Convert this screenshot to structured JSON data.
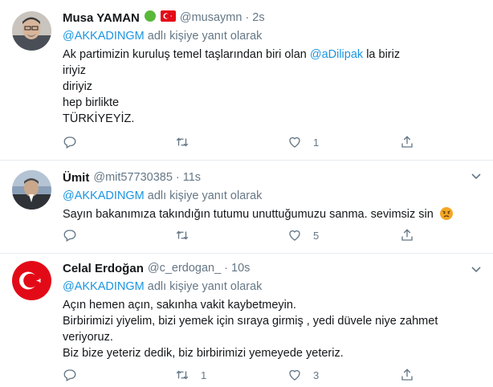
{
  "reply_prefix": "adlı kişiye yanıt olarak",
  "tweets": [
    {
      "name": "Musa YAMAN",
      "handle": "@musaymn",
      "time": "2s",
      "reply_to": "@AKKADINGM",
      "lines": [
        {
          "before": "Ak partimizin kuruluş temel taşlarından biri olan ",
          "mention": "@aDilipak",
          "after": " la biriz"
        },
        {
          "before": "iriyiz"
        },
        {
          "before": "diriyiz"
        },
        {
          "before": "hep birlikte"
        },
        {
          "before": "TÜRKİYEYİZ."
        }
      ],
      "retweets": "",
      "likes": "1"
    },
    {
      "name": "Ümit",
      "handle": "@mit57730385",
      "time": "11s",
      "reply_to": "@AKKADINGM",
      "lines": [
        {
          "before": "Sayın bakanımıza takındığın tutumu unuttuğumuzu sanma.  sevimsiz sin"
        }
      ],
      "retweets": "",
      "likes": "5"
    },
    {
      "name": "Celal Erdoğan",
      "handle": "@c_erdogan_",
      "time": "10s",
      "reply_to": "@AKKADINGM",
      "lines": [
        {
          "before": "Açın hemen açın, sakınha vakit kaybetmeyin."
        },
        {
          "before": "Birbirimizi yiyelim, bizi yemek için sıraya girmiş , yedi düvele niye zahmet"
        },
        {
          "before": "veriyoruz."
        },
        {
          "before": "Biz bize yeteriz dedik, biz birbirimizi yemeyede yeteriz."
        }
      ],
      "retweets": "1",
      "likes": "3"
    }
  ],
  "colors": {
    "accent": "#1b95e0",
    "secondary": "#657786",
    "divider": "#e6ecf0"
  }
}
